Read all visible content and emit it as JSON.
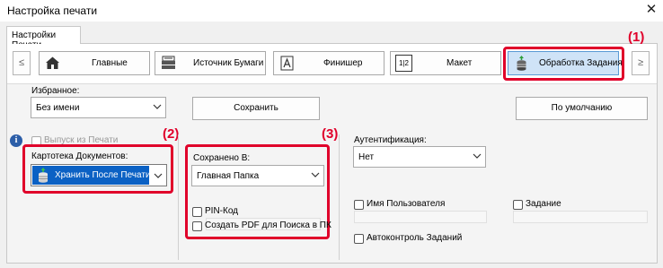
{
  "window": {
    "title": "Настройка печати",
    "close_glyph": "✕"
  },
  "tab": {
    "label": "Настройки Печати"
  },
  "nav": {
    "prev": "≤",
    "next": "≥",
    "items": [
      {
        "label": "Главные",
        "icon": "home-icon"
      },
      {
        "label": "Источник Бумаги",
        "icon": "paper-tray-icon"
      },
      {
        "label": "Финишер",
        "icon": "finisher-icon"
      },
      {
        "label": "Макет",
        "icon": "layout-icon",
        "icon_text": "1|2"
      },
      {
        "label": "Обработка Задания",
        "icon": "job-handling-icon"
      }
    ]
  },
  "favorites": {
    "label": "Избранное:",
    "value": "Без имени",
    "save_label": "Сохранить",
    "default_label": "По умолчанию"
  },
  "print_release": {
    "label": "Выпуск из Печати",
    "info_icon": "info-icon"
  },
  "document_filing": {
    "label": "Картотека Документов:",
    "value": "Хранить После Печати",
    "icon": "store-after-print-icon"
  },
  "stored_to": {
    "label": "Сохранено В:",
    "value": "Главная Папка",
    "pin_label": "PIN-Код",
    "pdf_label": "Создать PDF для Поиска в ПК"
  },
  "authentication": {
    "label": "Аутентификация:",
    "value": "Нет",
    "user_name_label": "Имя Пользователя",
    "job_label": "Задание",
    "job_audit_label": "Автоконтроль Заданий"
  },
  "callouts": {
    "c1": "(1)",
    "c2": "(2)",
    "c3": "(3)"
  },
  "colors": {
    "highlight": "#e0002a",
    "selected_tab": "#cfe3f7",
    "select_blue": "#0b61c4"
  }
}
